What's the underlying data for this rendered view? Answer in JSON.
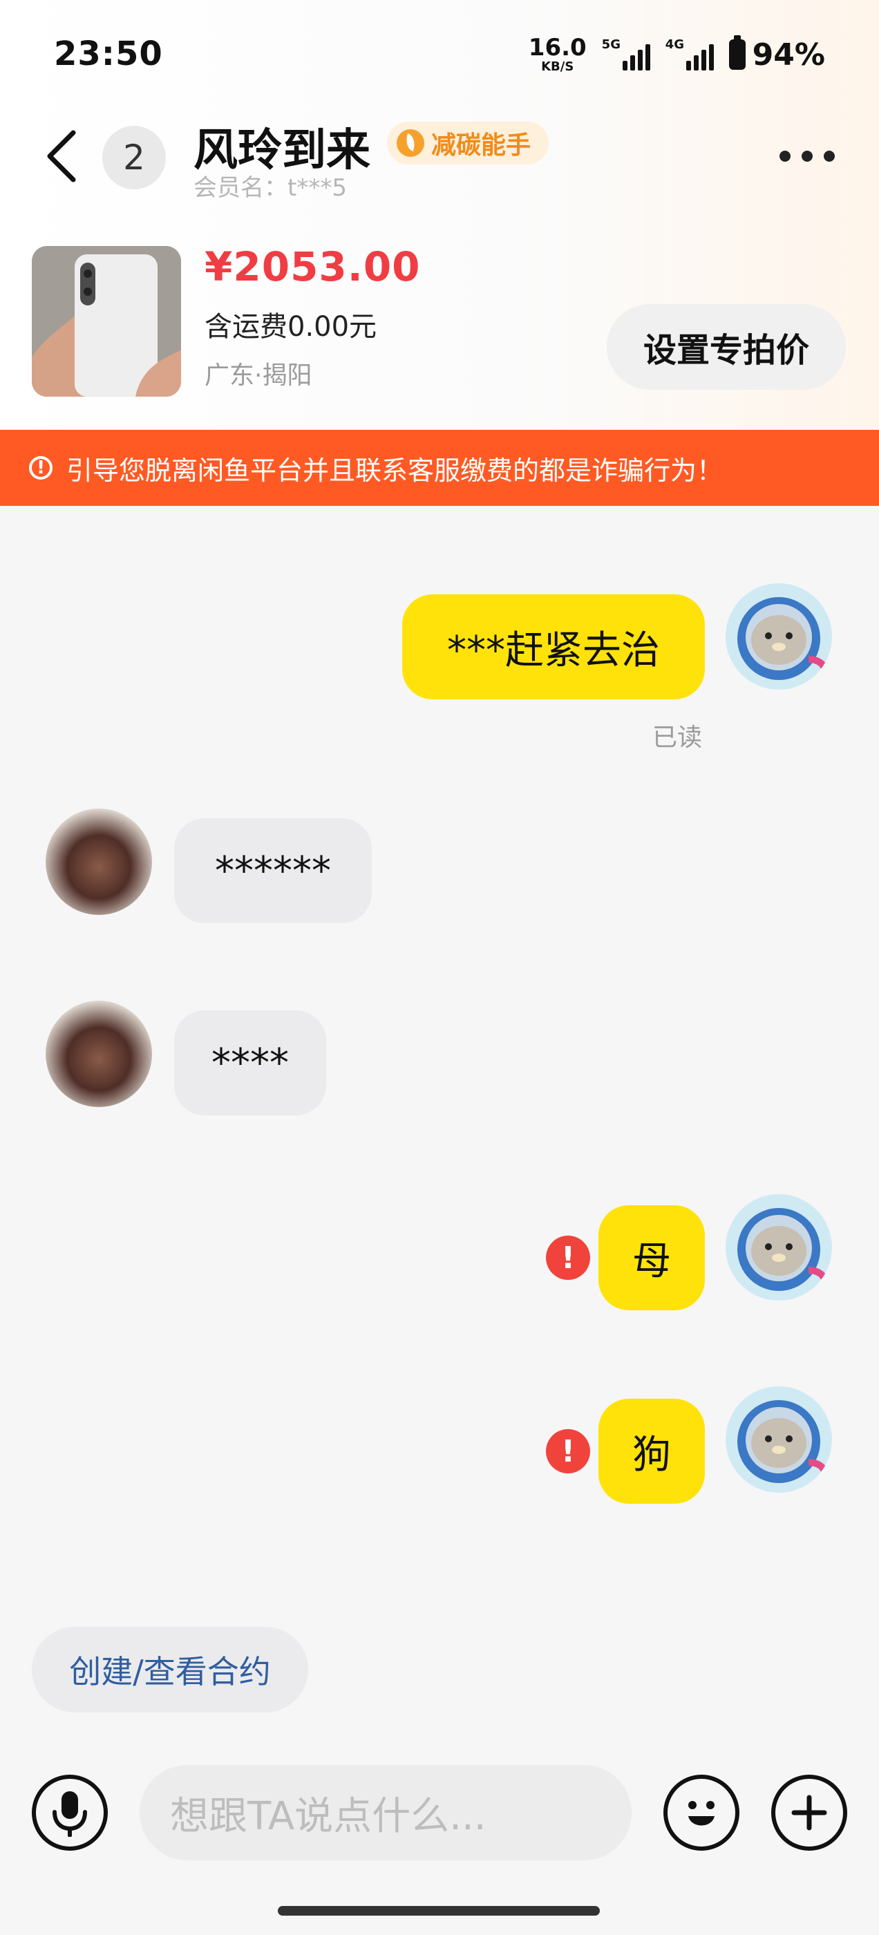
{
  "status": {
    "time": "23:50",
    "speed": "16.0",
    "speed_unit": "KB/S",
    "net1": "5G",
    "net2": "4G",
    "battery": "94%"
  },
  "header": {
    "unread_count": "2",
    "title": "风玲到来",
    "badge": "减碳能手",
    "member_label": "会员名：t***5"
  },
  "product": {
    "price": "¥2053.00",
    "shipping": "含运费0.00元",
    "location": "广东·揭阳",
    "special_price_button": "设置专拍价"
  },
  "warning": {
    "text": "引导您脱离闲鱼平台并且联系客服缴费的都是诈骗行为！"
  },
  "messages": [
    {
      "from": "me",
      "text": "***赶紧去治",
      "status": "已读"
    },
    {
      "from": "other",
      "text": "******"
    },
    {
      "from": "other",
      "text": "****"
    },
    {
      "from": "me",
      "text": "母",
      "error": true
    },
    {
      "from": "me",
      "text": "狗",
      "error": true
    }
  ],
  "contract_button": "创建/查看合约",
  "input": {
    "placeholder": "想跟TA说点什么..."
  },
  "colors": {
    "accent_yellow": "#ffe20a",
    "price_red": "#ef3d43",
    "warning_orange": "#ff5a24",
    "error_red": "#f0433c",
    "badge_orange": "#f08b1a"
  }
}
